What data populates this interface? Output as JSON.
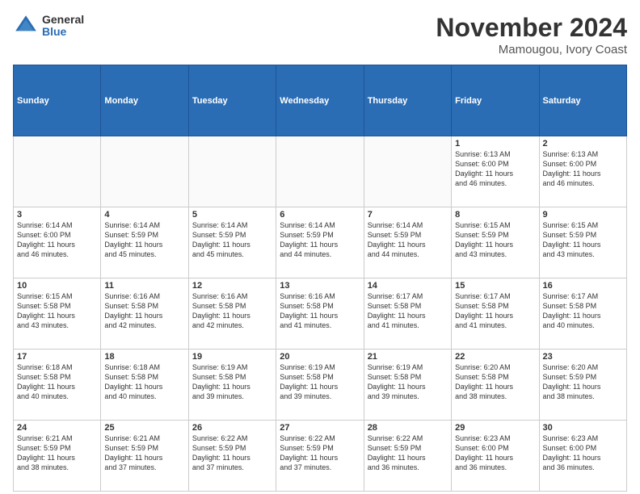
{
  "logo": {
    "general": "General",
    "blue": "Blue"
  },
  "title": "November 2024",
  "location": "Mamougou, Ivory Coast",
  "days": [
    "Sunday",
    "Monday",
    "Tuesday",
    "Wednesday",
    "Thursday",
    "Friday",
    "Saturday"
  ],
  "weeks": [
    [
      {
        "day": "",
        "info": ""
      },
      {
        "day": "",
        "info": ""
      },
      {
        "day": "",
        "info": ""
      },
      {
        "day": "",
        "info": ""
      },
      {
        "day": "",
        "info": ""
      },
      {
        "day": "1",
        "info": "Sunrise: 6:13 AM\nSunset: 6:00 PM\nDaylight: 11 hours\nand 46 minutes."
      },
      {
        "day": "2",
        "info": "Sunrise: 6:13 AM\nSunset: 6:00 PM\nDaylight: 11 hours\nand 46 minutes."
      }
    ],
    [
      {
        "day": "3",
        "info": "Sunrise: 6:14 AM\nSunset: 6:00 PM\nDaylight: 11 hours\nand 46 minutes."
      },
      {
        "day": "4",
        "info": "Sunrise: 6:14 AM\nSunset: 5:59 PM\nDaylight: 11 hours\nand 45 minutes."
      },
      {
        "day": "5",
        "info": "Sunrise: 6:14 AM\nSunset: 5:59 PM\nDaylight: 11 hours\nand 45 minutes."
      },
      {
        "day": "6",
        "info": "Sunrise: 6:14 AM\nSunset: 5:59 PM\nDaylight: 11 hours\nand 44 minutes."
      },
      {
        "day": "7",
        "info": "Sunrise: 6:14 AM\nSunset: 5:59 PM\nDaylight: 11 hours\nand 44 minutes."
      },
      {
        "day": "8",
        "info": "Sunrise: 6:15 AM\nSunset: 5:59 PM\nDaylight: 11 hours\nand 43 minutes."
      },
      {
        "day": "9",
        "info": "Sunrise: 6:15 AM\nSunset: 5:59 PM\nDaylight: 11 hours\nand 43 minutes."
      }
    ],
    [
      {
        "day": "10",
        "info": "Sunrise: 6:15 AM\nSunset: 5:58 PM\nDaylight: 11 hours\nand 43 minutes."
      },
      {
        "day": "11",
        "info": "Sunrise: 6:16 AM\nSunset: 5:58 PM\nDaylight: 11 hours\nand 42 minutes."
      },
      {
        "day": "12",
        "info": "Sunrise: 6:16 AM\nSunset: 5:58 PM\nDaylight: 11 hours\nand 42 minutes."
      },
      {
        "day": "13",
        "info": "Sunrise: 6:16 AM\nSunset: 5:58 PM\nDaylight: 11 hours\nand 41 minutes."
      },
      {
        "day": "14",
        "info": "Sunrise: 6:17 AM\nSunset: 5:58 PM\nDaylight: 11 hours\nand 41 minutes."
      },
      {
        "day": "15",
        "info": "Sunrise: 6:17 AM\nSunset: 5:58 PM\nDaylight: 11 hours\nand 41 minutes."
      },
      {
        "day": "16",
        "info": "Sunrise: 6:17 AM\nSunset: 5:58 PM\nDaylight: 11 hours\nand 40 minutes."
      }
    ],
    [
      {
        "day": "17",
        "info": "Sunrise: 6:18 AM\nSunset: 5:58 PM\nDaylight: 11 hours\nand 40 minutes."
      },
      {
        "day": "18",
        "info": "Sunrise: 6:18 AM\nSunset: 5:58 PM\nDaylight: 11 hours\nand 40 minutes."
      },
      {
        "day": "19",
        "info": "Sunrise: 6:19 AM\nSunset: 5:58 PM\nDaylight: 11 hours\nand 39 minutes."
      },
      {
        "day": "20",
        "info": "Sunrise: 6:19 AM\nSunset: 5:58 PM\nDaylight: 11 hours\nand 39 minutes."
      },
      {
        "day": "21",
        "info": "Sunrise: 6:19 AM\nSunset: 5:58 PM\nDaylight: 11 hours\nand 39 minutes."
      },
      {
        "day": "22",
        "info": "Sunrise: 6:20 AM\nSunset: 5:58 PM\nDaylight: 11 hours\nand 38 minutes."
      },
      {
        "day": "23",
        "info": "Sunrise: 6:20 AM\nSunset: 5:59 PM\nDaylight: 11 hours\nand 38 minutes."
      }
    ],
    [
      {
        "day": "24",
        "info": "Sunrise: 6:21 AM\nSunset: 5:59 PM\nDaylight: 11 hours\nand 38 minutes."
      },
      {
        "day": "25",
        "info": "Sunrise: 6:21 AM\nSunset: 5:59 PM\nDaylight: 11 hours\nand 37 minutes."
      },
      {
        "day": "26",
        "info": "Sunrise: 6:22 AM\nSunset: 5:59 PM\nDaylight: 11 hours\nand 37 minutes."
      },
      {
        "day": "27",
        "info": "Sunrise: 6:22 AM\nSunset: 5:59 PM\nDaylight: 11 hours\nand 37 minutes."
      },
      {
        "day": "28",
        "info": "Sunrise: 6:22 AM\nSunset: 5:59 PM\nDaylight: 11 hours\nand 36 minutes."
      },
      {
        "day": "29",
        "info": "Sunrise: 6:23 AM\nSunset: 6:00 PM\nDaylight: 11 hours\nand 36 minutes."
      },
      {
        "day": "30",
        "info": "Sunrise: 6:23 AM\nSunset: 6:00 PM\nDaylight: 11 hours\nand 36 minutes."
      }
    ]
  ]
}
